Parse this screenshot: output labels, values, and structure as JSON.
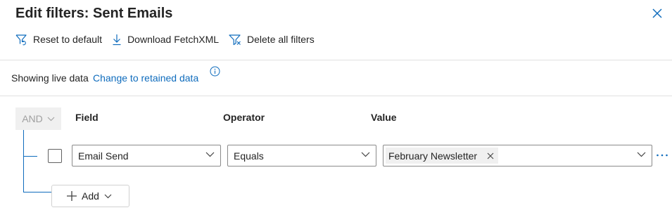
{
  "dialog": {
    "title": "Edit filters: Sent Emails"
  },
  "toolbar": {
    "reset_label": "Reset to default",
    "download_label": "Download FetchXML",
    "delete_label": "Delete all filters"
  },
  "data_mode": {
    "status_text": "Showing live data",
    "change_link": "Change to retained data"
  },
  "filter_group": {
    "logic_operator": "AND",
    "columns": {
      "field": "Field",
      "operator": "Operator",
      "value": "Value"
    },
    "rows": [
      {
        "field": "Email Send",
        "operator": "Equals",
        "value_tags": [
          "February Newsletter"
        ]
      }
    ],
    "add_label": "Add"
  },
  "colors": {
    "accent": "#0f6cbd",
    "text": "#242424",
    "disabled": "#a0a0a0"
  },
  "icons": [
    "reset-filter-icon",
    "download-icon",
    "clear-filter-icon",
    "close-icon",
    "info-icon",
    "chevron-down-icon",
    "dismiss-icon",
    "more-icon",
    "add-icon"
  ]
}
